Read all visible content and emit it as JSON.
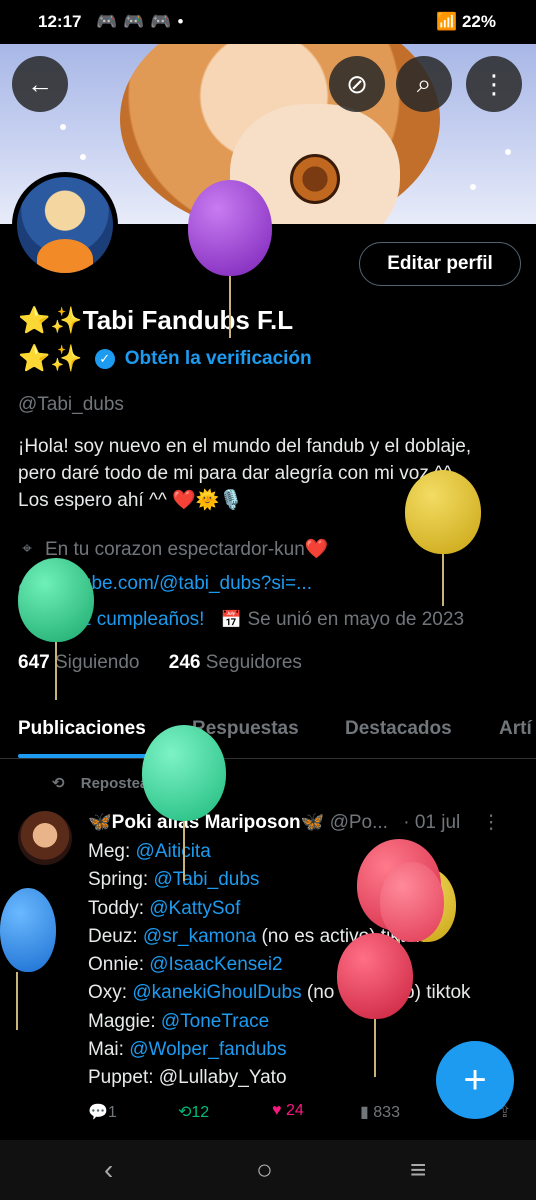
{
  "status_bar": {
    "time": "12:17",
    "app_icons": [
      "discord-icon",
      "discord-icon",
      "discord-icon",
      "dot-icon"
    ],
    "battery": "22%"
  },
  "header_buttons": {
    "back": "back-arrow-icon",
    "hide": "eye-slash-icon",
    "search": "search-icon",
    "more": "more-vert-icon"
  },
  "profile": {
    "edit_button": "Editar perfil",
    "name": "⭐✨Tabi Fandubs F.L",
    "name_line2": "⭐✨",
    "verify_text": "Obtén la verificación",
    "handle": "@Tabi_dubs",
    "bio": [
      "¡Hola! soy nuevo en el mundo del fandub y el doblaje,",
      "pero daré todo de mi para dar alegría con mi voz ^^",
      "Los espero ahí ^^ ❤️🌞🎙️"
    ],
    "location": "En tu corazon espectardor-kun❤️",
    "website": "youtube.com/@tabi_dubs?si=...",
    "birthday": "¡Feliz cumpleaños!",
    "joined": "Se unió en mayo de 2023",
    "following_count": "647",
    "following_label": "Siguiendo",
    "followers_count": "246",
    "followers_label": "Seguidores"
  },
  "tabs": [
    "Publicaciones",
    "Respuestas",
    "Destacados",
    "Artí"
  ],
  "post": {
    "repost_label": "Reposteaste",
    "author": "🦋Poki alias Mariposon🦋",
    "author_handle": "@Po...",
    "date": "· 01 jul",
    "lines": [
      {
        "prefix": "Meg: ",
        "mention": "@Aiticita",
        "suffix": ""
      },
      {
        "prefix": "Spring: ",
        "mention": "@Tabi_dubs",
        "suffix": ""
      },
      {
        "prefix": "Toddy: ",
        "mention": "@KattySof",
        "suffix": ""
      },
      {
        "prefix": "Deuz: ",
        "mention": "@sr_kamona",
        "suffix": " (no es activo) tiktok"
      },
      {
        "prefix": "Onnie: ",
        "mention": "@IsaacKensei2",
        "suffix": ""
      },
      {
        "prefix": "Oxy: ",
        "mention": "@kanekiGhoulDubs",
        "suffix": "  (no es activo) tiktok"
      },
      {
        "prefix": "Maggie: ",
        "mention": "@ToneTrace",
        "suffix": ""
      },
      {
        "prefix": "Mai: ",
        "mention": "@Wolper_fandubs",
        "suffix": ""
      },
      {
        "prefix": "Puppet: ",
        "mention": "",
        "suffix": "@Lullaby_Yato"
      }
    ],
    "replies": "1",
    "reposts": "12",
    "likes": "24",
    "views": "833"
  },
  "colors": {
    "accent": "#1d9bf0",
    "repost_green": "#00ba7c",
    "like_pink": "#f91880",
    "muted": "#71767b"
  }
}
